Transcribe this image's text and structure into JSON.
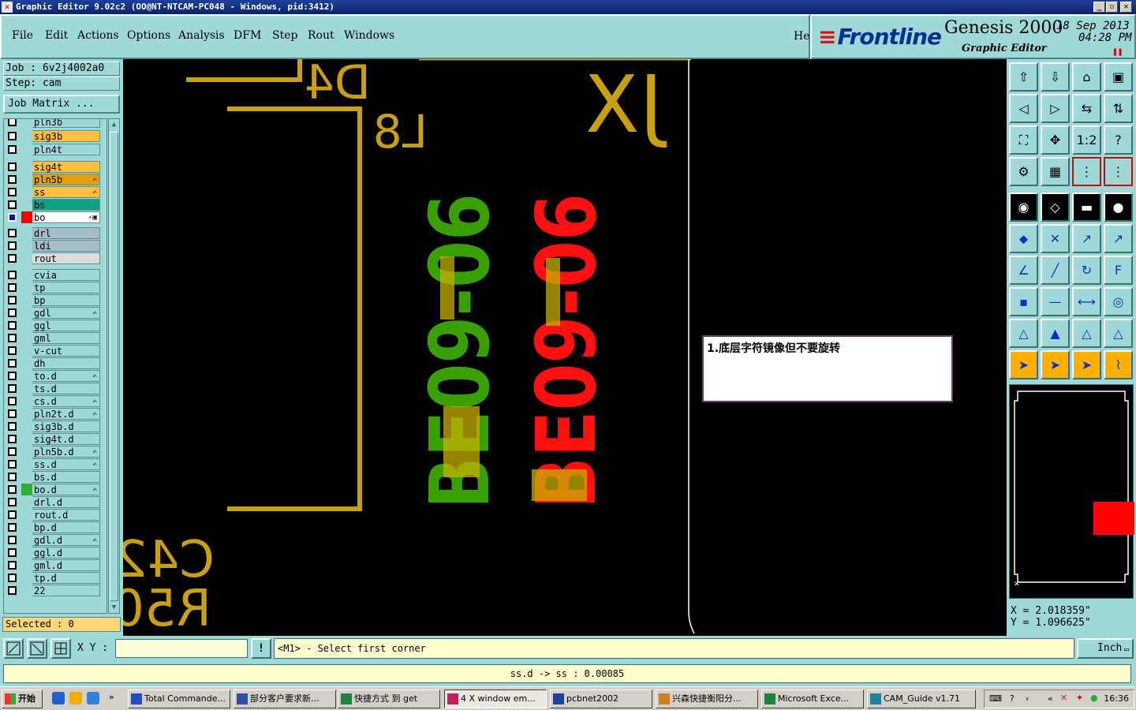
{
  "window": {
    "title": "Graphic Editor 9.02c2 (OO@NT-NTCAM-PC048 - Windows, pid:3412)"
  },
  "menu": [
    "File",
    "Edit",
    "Actions",
    "Options",
    "Analysis",
    "DFM",
    "Step",
    "Rout",
    "Windows"
  ],
  "help": "Help",
  "brand": {
    "logo": "Frontline",
    "product": "Genesis 2000",
    "subtitle": "Graphic Editor",
    "date": "18 Sep 2013",
    "time": "04:28 PM"
  },
  "job": {
    "job_label": "Job : 6v2j4002a0",
    "step_label": "Step: cam",
    "job_matrix": "Job Matrix ..."
  },
  "layers": [
    {
      "name": "pln3b",
      "bg": "#9ed8d8"
    },
    {
      "name": "sig3b",
      "bg": "#ffc040"
    },
    {
      "name": "pln4t",
      "bg": "#9ed8d8"
    },
    {
      "name": "sig4t",
      "bg": "#ffc040"
    },
    {
      "name": "pln5b",
      "bg": "#e0a010",
      "mark": "✍"
    },
    {
      "name": "ss",
      "bg": "#ffc040",
      "mark": "✍"
    },
    {
      "name": "bs",
      "bg": "#10a080"
    },
    {
      "name": "bo",
      "bg": "#ffffff",
      "swatch": "#ff0000",
      "mark": "✍▣"
    },
    {
      "name": "drl",
      "bg": "#a8bcc8"
    },
    {
      "name": "ldi",
      "bg": "#a8bcc8"
    },
    {
      "name": "rout",
      "bg": "#dcdcdc"
    },
    {
      "name": "cvia",
      "bg": "#9ed8d8"
    },
    {
      "name": "tp",
      "bg": "#9ed8d8"
    },
    {
      "name": "bp",
      "bg": "#9ed8d8"
    },
    {
      "name": "gdl",
      "bg": "#9ed8d8",
      "mark": "✍"
    },
    {
      "name": "ggl",
      "bg": "#9ed8d8"
    },
    {
      "name": "gml",
      "bg": "#9ed8d8"
    },
    {
      "name": "v-cut",
      "bg": "#9ed8d8"
    },
    {
      "name": "dh",
      "bg": "#9ed8d8"
    },
    {
      "name": "to.d",
      "bg": "#9ed8d8",
      "mark": "✍"
    },
    {
      "name": "ts.d",
      "bg": "#9ed8d8"
    },
    {
      "name": "cs.d",
      "bg": "#9ed8d8",
      "mark": "✍"
    },
    {
      "name": "pln2t.d",
      "bg": "#9ed8d8",
      "mark": "✍"
    },
    {
      "name": "sig3b.d",
      "bg": "#9ed8d8"
    },
    {
      "name": "sig4t.d",
      "bg": "#9ed8d8"
    },
    {
      "name": "pln5b.d",
      "bg": "#9ed8d8",
      "mark": "✍"
    },
    {
      "name": "ss.d",
      "bg": "#9ed8d8",
      "mark": "✍"
    },
    {
      "name": "bs.d",
      "bg": "#9ed8d8"
    },
    {
      "name": "bo.d",
      "bg": "#9ed8d8",
      "swatch": "#30b030",
      "mark": "✍"
    },
    {
      "name": "drl.d",
      "bg": "#9ed8d8"
    },
    {
      "name": "rout.d",
      "bg": "#9ed8d8"
    },
    {
      "name": "bp.d",
      "bg": "#9ed8d8"
    },
    {
      "name": "gdl.d",
      "bg": "#9ed8d8",
      "mark": "✍"
    },
    {
      "name": "ggl.d",
      "bg": "#9ed8d8"
    },
    {
      "name": "gml.d",
      "bg": "#9ed8d8"
    },
    {
      "name": "tp.d",
      "bg": "#9ed8d8"
    },
    {
      "name": "22",
      "bg": "#9ed8d8"
    }
  ],
  "selected": "Selected : 0",
  "canvas": {
    "labels": [
      "D4",
      "L8",
      "JX",
      "C42",
      "R50",
      "BE09-06",
      "BE09-06"
    ],
    "note": "1.底层字符镜像但不要旋转",
    "colors": {
      "outline": "#c8a010",
      "green": "#38a000",
      "red": "#ff1010",
      "mix": "#c8b000"
    }
  },
  "tools": [
    "open-job-icon",
    "check-in-icon",
    "home-icon",
    "window-icon",
    "import-icon",
    "export-icon",
    "reverse-icon",
    "flip-icon",
    "fit-icon",
    "center-icon",
    "scale-1-2-icon",
    "question-icon",
    "settings-icon",
    "grid-icon",
    "layers-red-icon",
    "layers-red2-icon",
    "snapshot-icon",
    "rectangle-icon",
    "ruler-icon",
    "dot-icon",
    "net-icon",
    "cross-icon",
    "line-point-icon",
    "point-move-icon",
    "angle-icon",
    "slash-icon",
    "arc-icon",
    "text-f-icon",
    "pad-icon",
    "minus-icon",
    "measure-icon",
    "circles-icon",
    "tri1-icon",
    "tri2-icon",
    "tri3-icon",
    "tri4-icon",
    "pointer-icon",
    "pointer-box-icon",
    "pointer-box2-icon",
    "route-icon"
  ],
  "coords": {
    "x": "X = 2.018359\"",
    "y": "Y = 1.096625\""
  },
  "command": {
    "xy_label": "X Y :",
    "xy_value": "",
    "excl": "!",
    "prompt": "<M1> - Select first corner",
    "units": "Inch"
  },
  "status": "ss.d -> ss : 0.00085",
  "taskbar": {
    "start": "开始",
    "tasks": [
      {
        "label": "Total Commande...",
        "color": "#2050c0"
      },
      {
        "label": "部分客户要求新...",
        "color": "#3050a0"
      },
      {
        "label": "快捷方式 到 get",
        "color": "#208040"
      },
      {
        "label": "4 X window em...",
        "color": "#c02060",
        "active": true
      },
      {
        "label": "pcbnet2002",
        "color": "#2040a0"
      },
      {
        "label": "兴森快捷衡阳分...",
        "color": "#d08020"
      },
      {
        "label": "Microsoft Exce...",
        "color": "#208040"
      },
      {
        "label": "CAM_Guide v1.71",
        "color": "#2080a0"
      }
    ],
    "clock": "16:36"
  }
}
